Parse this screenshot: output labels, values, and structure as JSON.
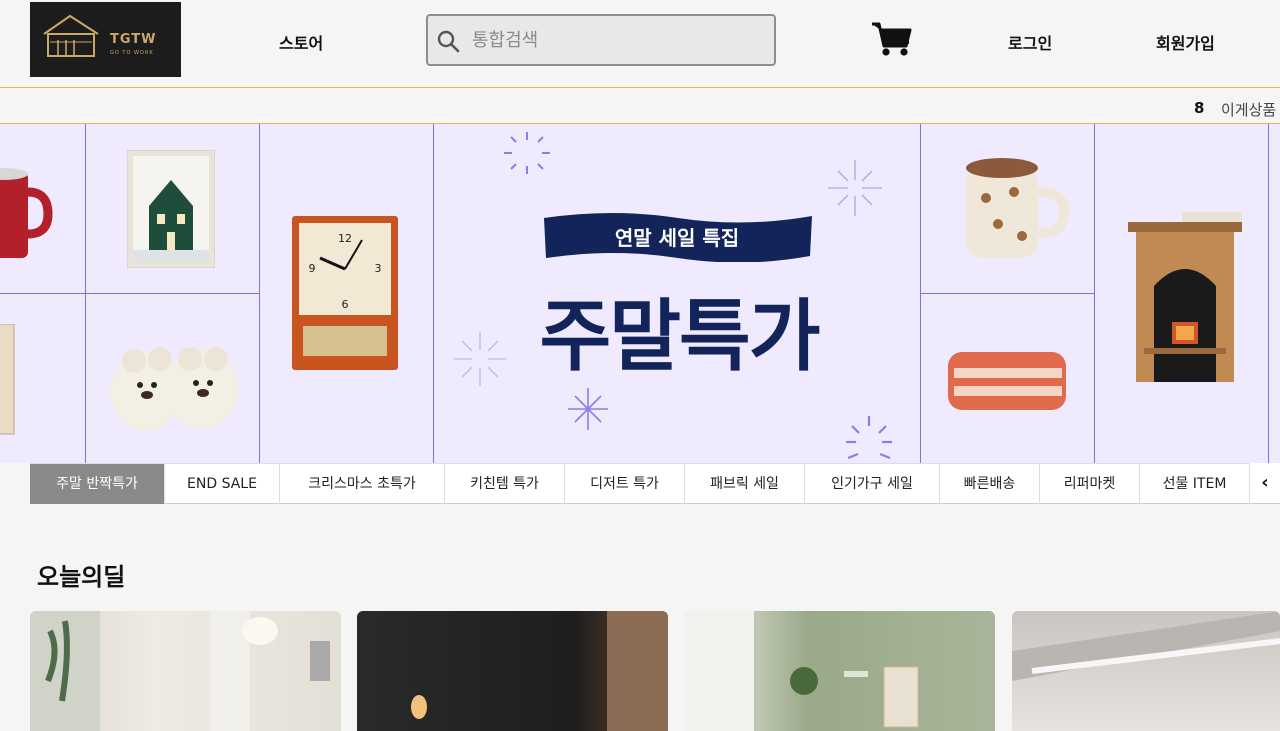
{
  "header": {
    "logo_text": "TGTW",
    "logo_sub": "GO TO WORK",
    "nav_store": "스토어",
    "search_placeholder": "통합검색",
    "login": "로그인",
    "signup": "회원가입",
    "icons": [
      "search-icon",
      "cart-icon"
    ]
  },
  "ticker": {
    "rank": "8",
    "text": "이게상품"
  },
  "banner": {
    "ribbon_text": "연말 세일 특집",
    "title": "주말특가"
  },
  "tabs": [
    {
      "label": "주말 반짝특가",
      "active": true
    },
    {
      "label": "END SALE"
    },
    {
      "label": "크리스마스 초특가"
    },
    {
      "label": "키친템 특가"
    },
    {
      "label": "디저트 특가"
    },
    {
      "label": "패브릭 세일"
    },
    {
      "label": "인기가구 세일"
    },
    {
      "label": "빠른배송"
    },
    {
      "label": "리퍼마켓"
    },
    {
      "label": "선물 ITEM"
    }
  ],
  "tab_prev_icon": "‹",
  "section": {
    "title": "오늘의딜"
  },
  "colors": {
    "banner_bg": "#efeafd",
    "navy": "#13245b",
    "accent_line": "#e6b84b"
  }
}
